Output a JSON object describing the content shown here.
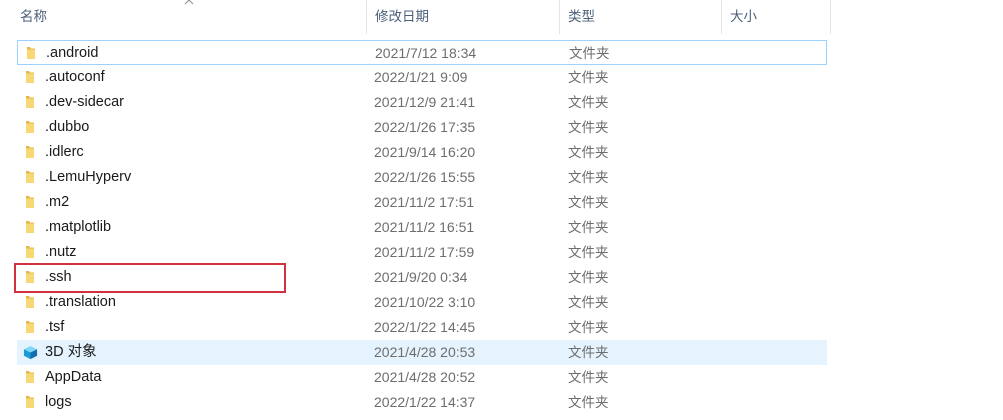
{
  "header": {
    "name": "名称",
    "date": "修改日期",
    "type": "类型",
    "size": "大小"
  },
  "accent": {
    "folder_yellow": "#f8d775",
    "folder_dark": "#e6b84a",
    "selection_bg": "#e5f3ff",
    "focus_border": "#99d1ff",
    "highlight_red": "#d0323e"
  },
  "files": [
    {
      "name": ".android",
      "date": "2021/7/12 18:34",
      "type": "文件夹",
      "icon": "folder-icon"
    },
    {
      "name": ".autoconf",
      "date": "2022/1/21 9:09",
      "type": "文件夹",
      "icon": "folder-icon"
    },
    {
      "name": ".dev-sidecar",
      "date": "2021/12/9 21:41",
      "type": "文件夹",
      "icon": "folder-icon"
    },
    {
      "name": ".dubbo",
      "date": "2022/1/26 17:35",
      "type": "文件夹",
      "icon": "folder-icon"
    },
    {
      "name": ".idlerc",
      "date": "2021/9/14 16:20",
      "type": "文件夹",
      "icon": "folder-icon"
    },
    {
      "name": ".LemuHyperv",
      "date": "2022/1/26 15:55",
      "type": "文件夹",
      "icon": "folder-icon"
    },
    {
      "name": ".m2",
      "date": "2021/11/2 17:51",
      "type": "文件夹",
      "icon": "folder-icon"
    },
    {
      "name": ".matplotlib",
      "date": "2021/11/2 16:51",
      "type": "文件夹",
      "icon": "folder-icon"
    },
    {
      "name": ".nutz",
      "date": "2021/11/2 17:59",
      "type": "文件夹",
      "icon": "folder-icon"
    },
    {
      "name": ".ssh",
      "date": "2021/9/20 0:34",
      "type": "文件夹",
      "icon": "folder-icon"
    },
    {
      "name": ".translation",
      "date": "2021/10/22 3:10",
      "type": "文件夹",
      "icon": "folder-icon"
    },
    {
      "name": ".tsf",
      "date": "2022/1/22 14:45",
      "type": "文件夹",
      "icon": "folder-icon"
    },
    {
      "name": "3D 对象",
      "date": "2021/4/28 20:53",
      "type": "文件夹",
      "icon": "3d-objects-icon"
    },
    {
      "name": "AppData",
      "date": "2021/4/28 20:52",
      "type": "文件夹",
      "icon": "folder-icon"
    },
    {
      "name": "logs",
      "date": "2022/1/22 14:37",
      "type": "文件夹",
      "icon": "folder-icon"
    }
  ]
}
